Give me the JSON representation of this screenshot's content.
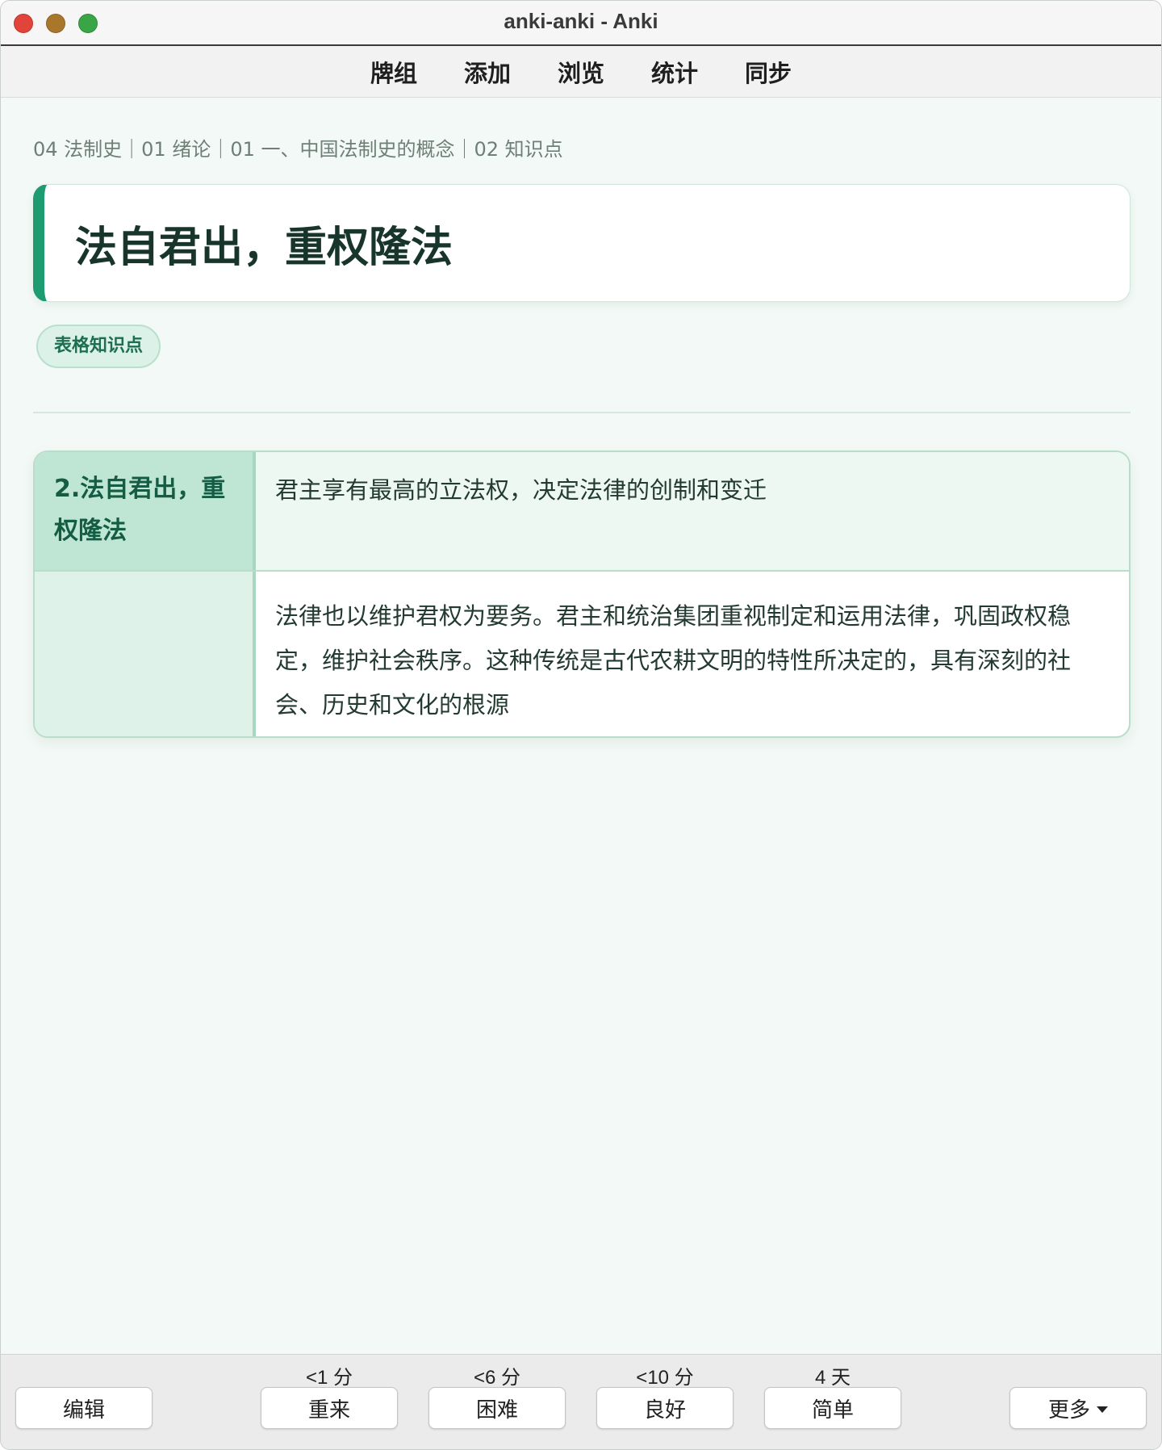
{
  "window": {
    "title": "anki-anki - Anki"
  },
  "topnav": {
    "items": [
      "牌组",
      "添加",
      "浏览",
      "统计",
      "同步"
    ]
  },
  "card": {
    "breadcrumb": "04 法制史｜01 绪论｜01 一、中国法制史的概念｜02 知识点",
    "title": "法自君出，重权隆法",
    "tag": "表格知识点",
    "table": {
      "head_left": "2.法自君出，重权隆法",
      "head_right": "君主享有最高的立法权，决定法律的创制和变迁",
      "body_left": "",
      "body_right": "法律也以维护君权为要务。君主和统治集团重视制定和运用法律，巩固政权稳定，维护社会秩序。这种传统是古代农耕文明的特性所决定的，具有深刻的社会、历史和文化的根源"
    }
  },
  "bottombar": {
    "edit": "编辑",
    "answers": [
      {
        "interval": "<1 分",
        "label": "重来"
      },
      {
        "interval": "<6 分",
        "label": "困难"
      },
      {
        "interval": "<10 分",
        "label": "良好"
      },
      {
        "interval": "4 天",
        "label": "简单"
      }
    ],
    "more": "更多"
  },
  "colors": {
    "accent": "#1e9b70",
    "background": "#f3f9f6",
    "table_header": "#bfe6d4",
    "title_text": "#17352a"
  }
}
